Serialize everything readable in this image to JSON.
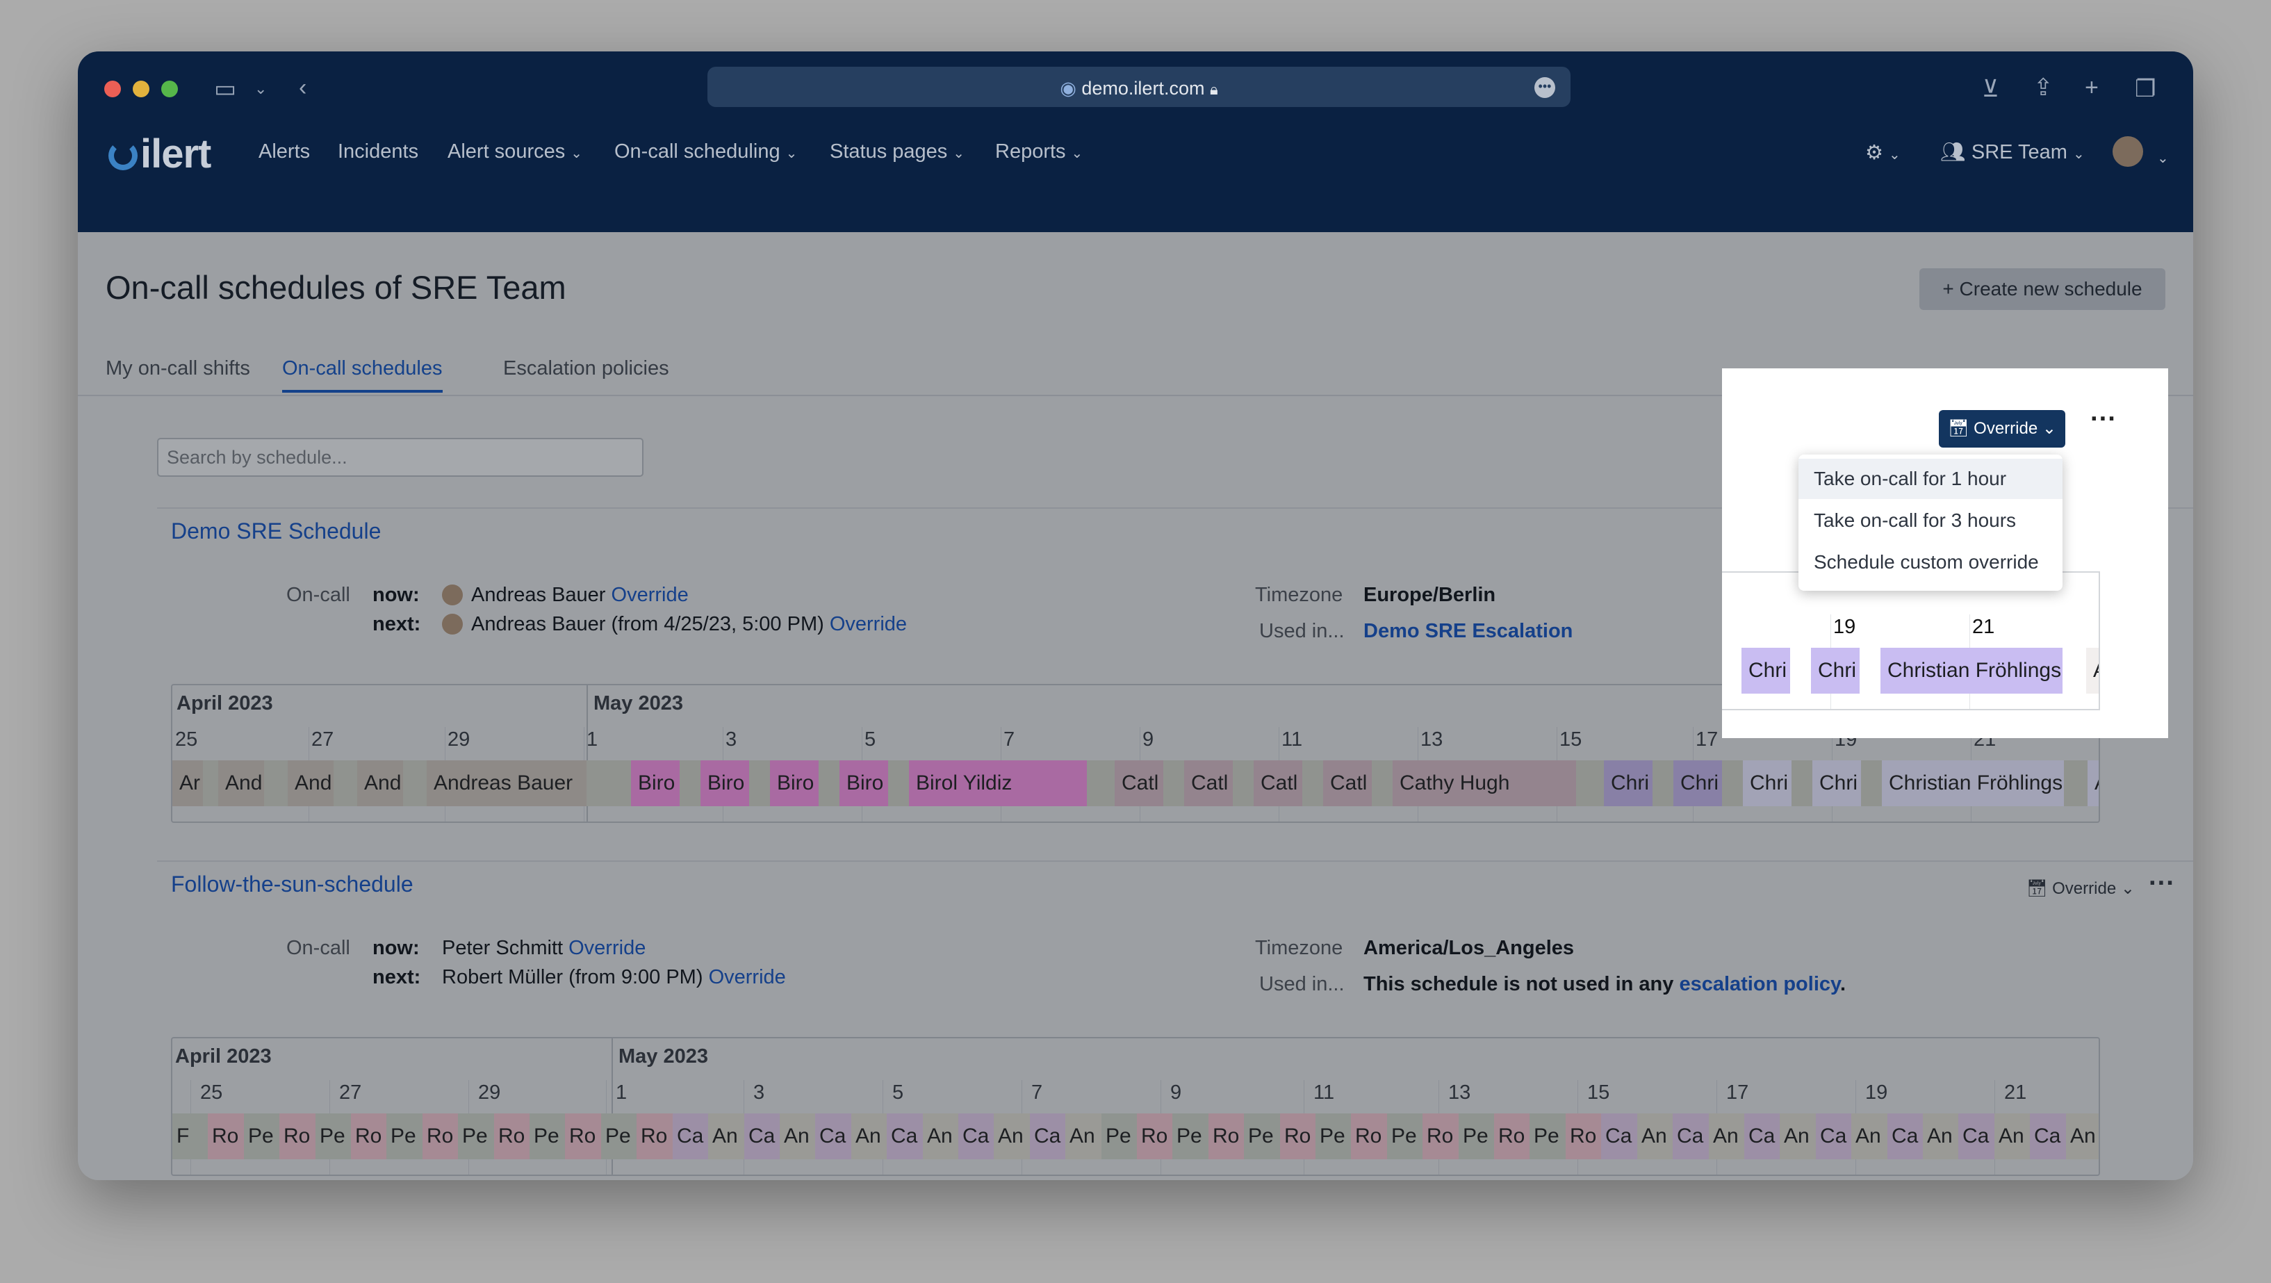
{
  "browser": {
    "url": "demo.ilert.com",
    "icons": [
      "sidebar-icon",
      "chevron-left-icon",
      "lock-icon",
      "more-icon",
      "download-icon",
      "share-icon",
      "plus-icon",
      "tabs-icon"
    ]
  },
  "nav": {
    "logo": "ilert",
    "items": [
      {
        "label": "Alerts",
        "caret": false
      },
      {
        "label": "Incidents",
        "caret": false
      },
      {
        "label": "Alert sources",
        "caret": true
      },
      {
        "label": "On-call scheduling",
        "caret": true
      },
      {
        "label": "Status pages",
        "caret": true
      },
      {
        "label": "Reports",
        "caret": true
      }
    ],
    "team": "SRE Team"
  },
  "page": {
    "title": "On-call schedules of SRE Team",
    "create_button": "+ Create new schedule",
    "tabs": [
      "My on-call shifts",
      "On-call schedules",
      "Escalation policies"
    ],
    "active_tab": "On-call schedules",
    "search_placeholder": "Search by schedule..."
  },
  "labels": {
    "on_call": "On-call",
    "now": "now:",
    "next": "next:",
    "timezone": "Timezone",
    "used_in": "Used in...",
    "override": "Override"
  },
  "schedules": [
    {
      "title": "Demo SRE Schedule",
      "now_name": "Andreas Bauer",
      "next_name": "Andreas Bauer  (from 4/25/23, 5:00 PM)",
      "timezone": "Europe/Berlin",
      "used_in": "Demo SRE Escalation",
      "timeline": {
        "months": [
          "April 2023",
          "May 2023"
        ],
        "days": [
          "25",
          "27",
          "29",
          "1",
          "3",
          "5",
          "7",
          "9",
          "11",
          "13",
          "15",
          "17",
          "19",
          "21"
        ],
        "shifts": [
          {
            "name": "Andreas Bauer",
            "label": "Ar",
            "color": "#8e8a87"
          },
          {
            "name": "Andreas Bauer",
            "label": "And",
            "color": "#8e8a87"
          },
          {
            "name": "Andreas Bauer",
            "label": "And",
            "color": "#8e8a87"
          },
          {
            "name": "Andreas Bauer",
            "label": "And",
            "color": "#8e8a87"
          },
          {
            "name": "Andreas Bauer",
            "label": "Andreas Bauer",
            "color": "#8e8a87"
          },
          {
            "name": "Birol Yildiz",
            "label": "Biro",
            "color": "#a96aa2"
          },
          {
            "name": "Birol Yildiz",
            "label": "Biro",
            "color": "#a96aa2"
          },
          {
            "name": "Birol Yildiz",
            "label": "Biro",
            "color": "#a96aa2"
          },
          {
            "name": "Birol Yildiz",
            "label": "Biro",
            "color": "#a96aa2"
          },
          {
            "name": "Birol Yildiz",
            "label": "Birol Yildiz",
            "color": "#a96aa2"
          },
          {
            "name": "Cathy Hugh",
            "label": "Catl",
            "color": "#94848e"
          },
          {
            "name": "Cathy Hugh",
            "label": "Catl",
            "color": "#94848e"
          },
          {
            "name": "Cathy Hugh",
            "label": "Catl",
            "color": "#94848e"
          },
          {
            "name": "Cathy Hugh",
            "label": "Catl",
            "color": "#94848e"
          },
          {
            "name": "Cathy Hugh",
            "label": "Cathy Hugh",
            "color": "#94848e"
          },
          {
            "name": "Christian Fröhlings",
            "label": "Chri",
            "color": "#8880a6"
          },
          {
            "name": "Christian Fröhlings",
            "label": "Chri",
            "color": "#8880a6"
          },
          {
            "name": "Christian Fröhlings",
            "label": "Chri",
            "color": "#c9bdf2"
          },
          {
            "name": "Christian Fröhlings",
            "label": "Chri",
            "color": "#c9bdf2"
          },
          {
            "name": "Christian Fröhlings",
            "label": "Christian Fröhlings",
            "color": "#c9bdf2"
          },
          {
            "name": "Andreas Bauer",
            "label": "A",
            "color": "#f2efee"
          }
        ]
      }
    },
    {
      "title": "Follow-the-sun-schedule",
      "now_name": "Peter Schmitt",
      "next_name": "Robert Müller  (from 9:00 PM)",
      "timezone": "America/Los_Angeles",
      "used_in_prefix": "This schedule is not used in any ",
      "used_in_link": "escalation policy",
      "used_in_suffix": ".",
      "timeline": {
        "months": [
          "April 2023",
          "May 2023"
        ],
        "days": [
          "25",
          "27",
          "29",
          "1",
          "3",
          "5",
          "7",
          "9",
          "11",
          "13",
          "15",
          "17",
          "19",
          "21"
        ],
        "labels": [
          "F",
          "Ro",
          "Pe",
          "Ro",
          "Pe",
          "Ro",
          "Pe",
          "Ro",
          "Pe",
          "Ro",
          "Pe",
          "Ro",
          "Pe",
          "Ro",
          "Ca",
          "An",
          "Ca",
          "An",
          "Ca",
          "An",
          "Ca",
          "An",
          "Ca",
          "An",
          "Ca",
          "An",
          "Pe",
          "Ro",
          "Pe",
          "Ro",
          "Pe",
          "Ro",
          "Pe",
          "Ro",
          "Pe",
          "Ro",
          "Pe",
          "Ro",
          "Pe",
          "Ro",
          "Ca",
          "An",
          "Ca",
          "An",
          "Ca",
          "An",
          "Ca",
          "An",
          "Ca",
          "An",
          "Ca",
          "An",
          "Ca",
          "An"
        ]
      }
    }
  ],
  "dropdown": {
    "button": "Override",
    "items": [
      "Take on-call for 1 hour",
      "Take on-call for 3 hours",
      "Schedule custom override"
    ]
  },
  "colors": {
    "nav_bg": "#0a2142",
    "link": "#15408a",
    "override_btn": "#13355f"
  }
}
